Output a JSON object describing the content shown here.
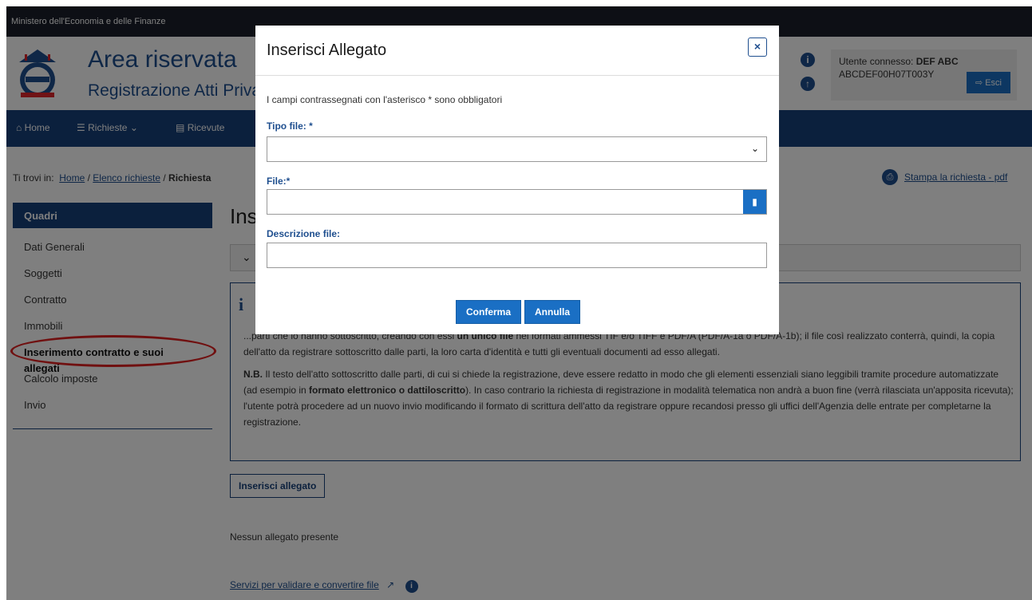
{
  "topbar": {
    "org": "Ministero dell'Economia e delle Finanze"
  },
  "brand": {
    "title": "Area riservata",
    "subtitle": "Registrazione Atti Privati"
  },
  "user": {
    "label": "Utente connesso:",
    "name": "DEF ABC",
    "code": "ABCDEF00H07T003Y",
    "logout": "Esci"
  },
  "nav": {
    "home": "Home",
    "richieste": "Richieste",
    "ricevute": "Ricevute"
  },
  "breadcrumb": {
    "prefix": "Ti trovi in:",
    "home": "Home",
    "sep": "/",
    "elenco": "Elenco richieste",
    "current": "Richiesta"
  },
  "print_link": "Stampa la richiesta - pdf",
  "sidebar": {
    "heading": "Quadri",
    "items": [
      {
        "label": "Dati Generali"
      },
      {
        "label": "Soggetti"
      },
      {
        "label": "Contratto"
      },
      {
        "label": "Immobili"
      },
      {
        "label": "Inserimento contratto e suoi allegati"
      },
      {
        "label": "Calcolo imposte"
      },
      {
        "label": "Invio"
      }
    ]
  },
  "main": {
    "title": "Inserimento contratto e suoi allegati",
    "info": {
      "p1_start": "...parti che lo hanno sottoscritto, creando con essi ",
      "p1_bold1": "un unico file",
      "p1_mid": " nei formati ammessi TIF e/o TIFF e PDF/A (PDF/A-1a o PDF/A-1b); il file così realizzato conterrà, quindi, la copia dell'atto da registrare sottoscritto dalle parti, la loro carta d'identità e tutti gli eventuali documenti ad esso allegati.",
      "p2_bold": "N.B.",
      "p2_start": " Il testo dell'atto sottoscritto dalle parti, di cui si chiede la registrazione, deve essere redatto in modo che gli elementi essenziali siano leggibili tramite procedure automatizzate (ad esempio in ",
      "p2_bold2": "formato elettronico o dattiloscritto",
      "p2_end": "). In caso contrario la richiesta di registrazione in modalità telematica non andrà a buon fine (verrà rilasciata un'apposita ricevuta); l'utente potrà procedere ad un nuovo invio modificando il formato di scrittura dell'atto da registrare oppure recandosi presso gli uffici dell'Agenzia delle entrate per completarne la registrazione."
    },
    "add_button": "Inserisci allegato",
    "empty_text": "Nessun allegato presente",
    "services_link": "Servizi per validare e convertire file"
  },
  "modal": {
    "title": "Inserisci Allegato",
    "close": "×",
    "note": "I campi contrassegnati con l'asterisco * sono obbligatori",
    "tipo_label": "Tipo file: *",
    "tipo_value": "",
    "file_label": "File:*",
    "file_value": "",
    "desc_label": "Descrizione file:",
    "desc_value": "",
    "confirm": "Conferma",
    "cancel": "Annulla"
  },
  "colors": {
    "primary": "#1f4f8f",
    "nav": "#17407a",
    "button": "#1a6fc4",
    "highlight": "#e02020"
  }
}
